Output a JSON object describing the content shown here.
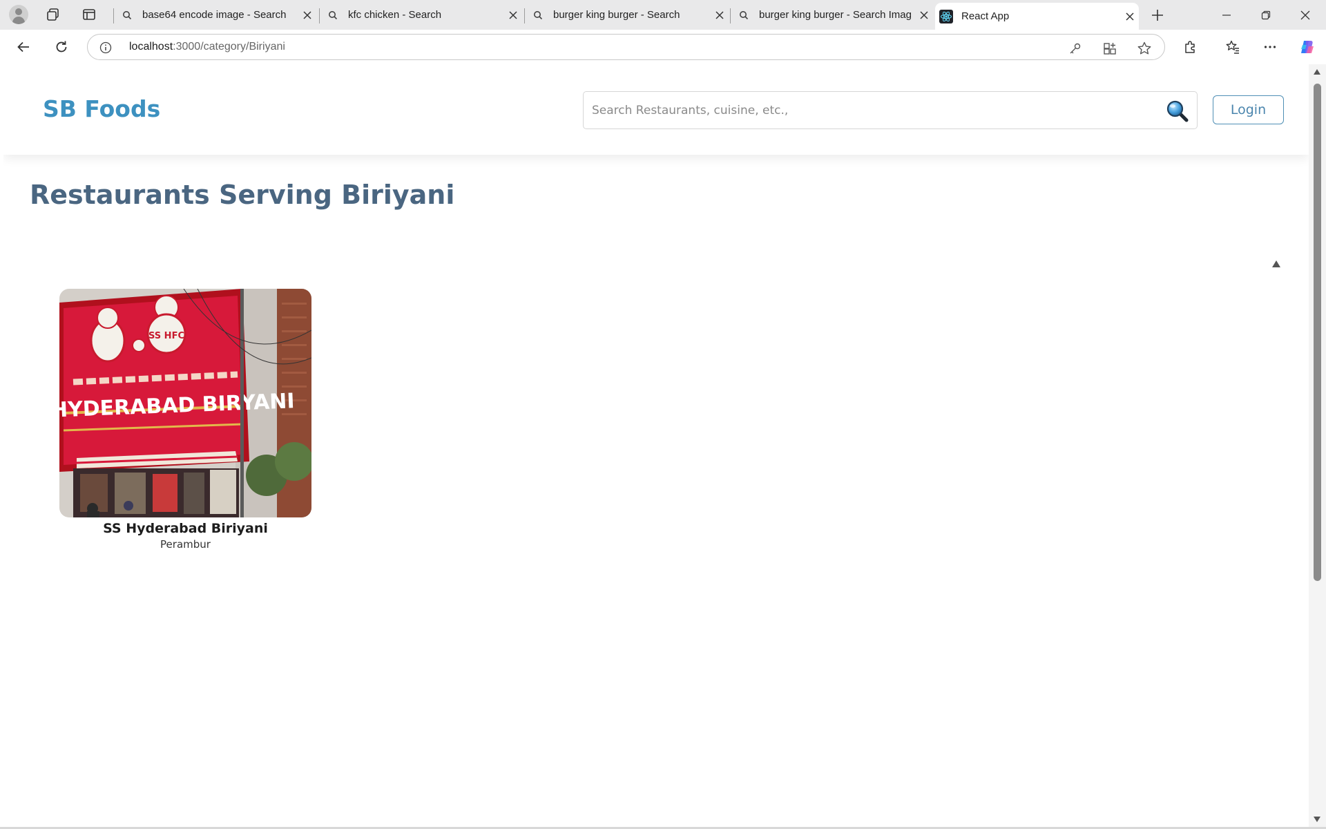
{
  "browser": {
    "tabs": [
      {
        "label": "base64 encode image - Search",
        "icon": "search-icon",
        "active": false
      },
      {
        "label": "kfc chicken - Search",
        "icon": "search-icon",
        "active": false
      },
      {
        "label": "burger king burger - Search",
        "icon": "search-icon",
        "active": false
      },
      {
        "label": "burger king burger - Search Imag",
        "icon": "search-icon",
        "active": false
      },
      {
        "label": "React App",
        "icon": "react-icon",
        "active": true
      }
    ],
    "url_host": "localhost",
    "url_path": ":3000/category/Biriyani"
  },
  "site": {
    "brand": "SB Foods",
    "search_placeholder": "Search Restaurants, cuisine, etc.,",
    "login_label": "Login",
    "accent_color": "#3d91c0"
  },
  "page": {
    "title": "Restaurants Serving Biriyani",
    "restaurants": [
      {
        "name": "SS Hyderabad Biriyani",
        "area": "Perambur",
        "sign_text": "SS HYDERABAD BIRYANI",
        "logo_text": "SS HFC"
      }
    ]
  }
}
